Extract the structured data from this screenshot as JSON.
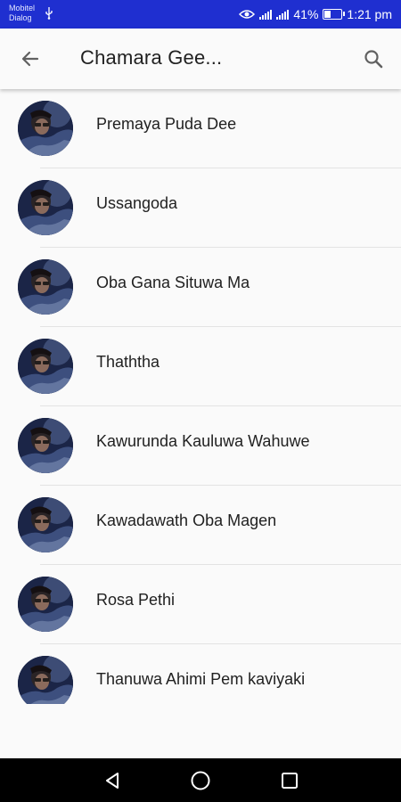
{
  "status_bar": {
    "carrier_1": "Mobitel",
    "carrier_2": "Dialog",
    "battery_text": "41%",
    "battery_level": 0.41,
    "time": "1:21 pm"
  },
  "app_bar": {
    "title": "Chamara Gee...",
    "back_icon": "arrow-back-icon",
    "search_icon": "search-icon"
  },
  "songs": [
    {
      "title": "Premaya Puda Dee"
    },
    {
      "title": "Ussangoda"
    },
    {
      "title": "Oba Gana Situwa Ma"
    },
    {
      "title": "Thaththa"
    },
    {
      "title": "Kawurunda Kauluwa Wahuwe"
    },
    {
      "title": "Kawadawath Oba Magen"
    },
    {
      "title": "Rosa Pethi"
    },
    {
      "title": "Thanuwa Ahimi Pem kaviyaki"
    }
  ],
  "nav_bar": {
    "back_icon": "triangle-back-icon",
    "home_icon": "circle-home-icon",
    "recents_icon": "square-recents-icon"
  },
  "colors": {
    "status_bar": "#1f2fd0",
    "background": "#fafafa",
    "text": "#212121",
    "nav_bar": "#000000"
  }
}
